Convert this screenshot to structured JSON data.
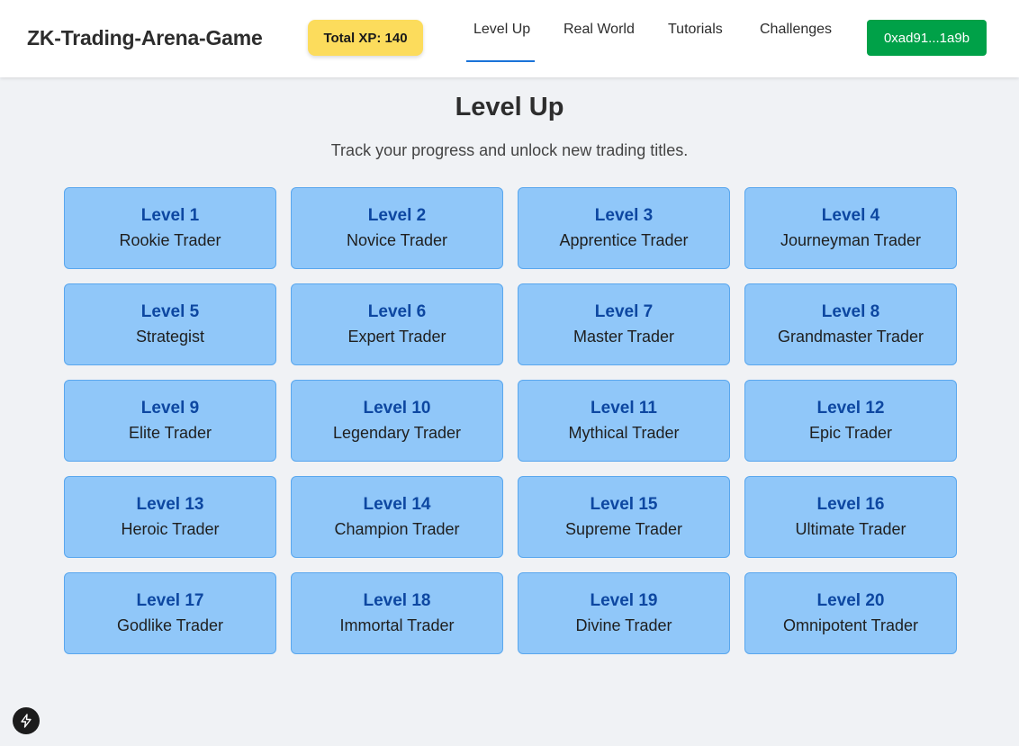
{
  "header": {
    "brand": "ZK-Trading-Arena-Game",
    "xp_badge": "Total XP: 140",
    "nav": [
      {
        "label": "Level Up",
        "active": true
      },
      {
        "label": "Real World",
        "active": false
      },
      {
        "label": "Tutorials",
        "active": false
      },
      {
        "label": "Challenges",
        "active": false
      }
    ],
    "wallet_label": "0xad91...1a9b"
  },
  "main": {
    "title": "Level Up",
    "subtitle": "Track your progress and unlock new trading titles.",
    "levels": [
      {
        "level": "Level 1",
        "title": "Rookie Trader"
      },
      {
        "level": "Level 2",
        "title": "Novice Trader"
      },
      {
        "level": "Level 3",
        "title": "Apprentice Trader"
      },
      {
        "level": "Level 4",
        "title": "Journeyman Trader"
      },
      {
        "level": "Level 5",
        "title": "Strategist"
      },
      {
        "level": "Level 6",
        "title": "Expert Trader"
      },
      {
        "level": "Level 7",
        "title": "Master Trader"
      },
      {
        "level": "Level 8",
        "title": "Grandmaster Trader"
      },
      {
        "level": "Level 9",
        "title": "Elite Trader"
      },
      {
        "level": "Level 10",
        "title": "Legendary Trader"
      },
      {
        "level": "Level 11",
        "title": "Mythical Trader"
      },
      {
        "level": "Level 12",
        "title": "Epic Trader"
      },
      {
        "level": "Level 13",
        "title": "Heroic Trader"
      },
      {
        "level": "Level 14",
        "title": "Champion Trader"
      },
      {
        "level": "Level 15",
        "title": "Supreme Trader"
      },
      {
        "level": "Level 16",
        "title": "Ultimate Trader"
      },
      {
        "level": "Level 17",
        "title": "Godlike Trader"
      },
      {
        "level": "Level 18",
        "title": "Immortal Trader"
      },
      {
        "level": "Level 19",
        "title": "Divine Trader"
      },
      {
        "level": "Level 20",
        "title": "Omnipotent Trader"
      }
    ]
  },
  "colors": {
    "accent": "#1a73d9",
    "xp_badge": "#fcdc5c",
    "wallet_button": "#00a148",
    "card_bg": "#90c7f9",
    "card_border": "#5aa7ee",
    "level_text": "#0d47a1"
  },
  "icons": {
    "dev_tools": "lightning-bolt-icon"
  }
}
